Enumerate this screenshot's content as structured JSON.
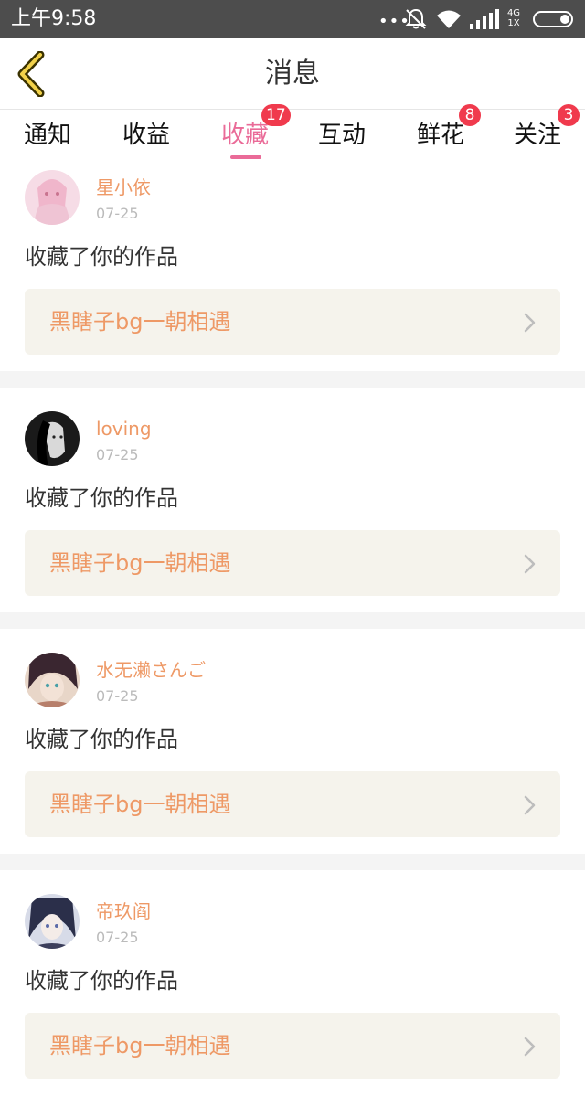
{
  "status_bar": {
    "time": "上午9:58",
    "dots": "•••",
    "network_top": "4G",
    "network_bottom": "1X"
  },
  "header": {
    "title": "消息"
  },
  "tabs": [
    {
      "label": "通知",
      "badge": null
    },
    {
      "label": "收益",
      "badge": null
    },
    {
      "label": "收藏",
      "badge": "17",
      "active": true
    },
    {
      "label": "互动",
      "badge": null
    },
    {
      "label": "鲜花",
      "badge": "8"
    },
    {
      "label": "关注",
      "badge": "3"
    }
  ],
  "colors": {
    "accent": "#ea6b98",
    "name": "#ee9966",
    "badge": "#f03a4d",
    "work_bg": "#f5f3ec"
  },
  "items": [
    {
      "user": "星小依",
      "date": "07-25",
      "action": "收藏了你的作品",
      "work": "黑瞎子bg一朝相遇",
      "avatar_icon": "avatar-pink-hair-icon"
    },
    {
      "user": "loving",
      "date": "07-25",
      "action": "收藏了你的作品",
      "work": "黑瞎子bg一朝相遇",
      "avatar_icon": "avatar-monochrome-girl-icon"
    },
    {
      "user": "水无濑さんご",
      "date": "07-25",
      "action": "收藏了你的作品",
      "work": "黑瞎子bg一朝相遇",
      "avatar_icon": "avatar-dark-hair-girl-icon"
    },
    {
      "user": "帝玖阎",
      "date": "07-25",
      "action": "收藏了你的作品",
      "work": "黑瞎子bg一朝相遇",
      "avatar_icon": "avatar-anime-girl-icon"
    }
  ]
}
